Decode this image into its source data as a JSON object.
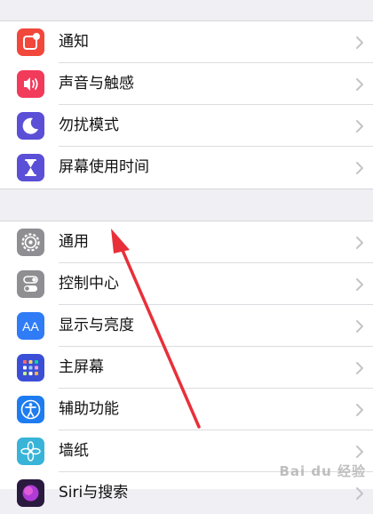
{
  "settings": {
    "group1": [
      {
        "label": "通知",
        "icon": "notifications-icon",
        "color": "#f2473b"
      },
      {
        "label": "声音与触感",
        "icon": "speaker-icon",
        "color": "#f23a5a"
      },
      {
        "label": "勿扰模式",
        "icon": "moon-icon",
        "color": "#5a4fd6"
      },
      {
        "label": "屏幕使用时间",
        "icon": "hourglass-icon",
        "color": "#5a4fd6"
      }
    ],
    "group2": [
      {
        "label": "通用",
        "icon": "gear-icon",
        "color": "#8e8e93"
      },
      {
        "label": "控制中心",
        "icon": "toggle-icon",
        "color": "#8e8e93"
      },
      {
        "label": "显示与亮度",
        "icon": "text-size-icon",
        "color": "#2f7cf6",
        "glyph": "AA"
      },
      {
        "label": "主屏幕",
        "icon": "home-screen-grid-icon",
        "color": "#3a4fd6"
      },
      {
        "label": "辅助功能",
        "icon": "accessibility-icon",
        "color": "#1e7cf0"
      },
      {
        "label": "墙纸",
        "icon": "wallpaper-flower-icon",
        "color": "#38b4d8"
      },
      {
        "label": "Siri与搜索",
        "icon": "siri-icon",
        "color": "#2b1a3f"
      }
    ]
  },
  "watermark": "Bai du 经验",
  "annotation_color": "#e8303a"
}
